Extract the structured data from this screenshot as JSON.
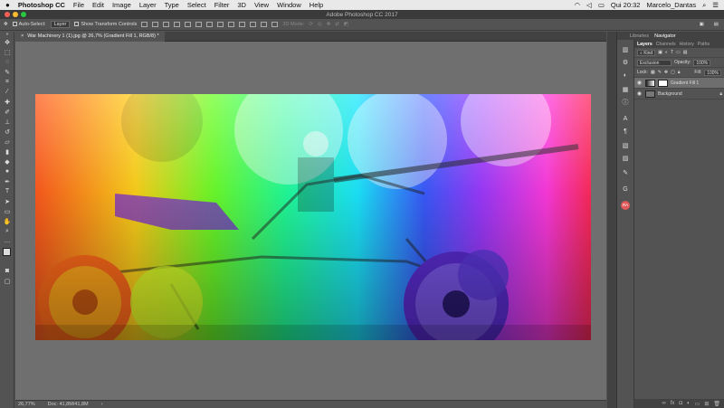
{
  "menubar": {
    "apple": "",
    "app_name": "Photoshop CC",
    "items": [
      "File",
      "Edit",
      "Image",
      "Layer",
      "Type",
      "Select",
      "Filter",
      "3D",
      "View",
      "Window",
      "Help"
    ],
    "clock": "Qui 20:32",
    "user": "Marcelo_Dantas"
  },
  "window": {
    "title": "Adobe Photoshop CC 2017"
  },
  "options": {
    "auto_select_label": "Auto-Select:",
    "auto_select_value": "Layer",
    "show_transform_label": "Show Transform Controls",
    "mode_3d": "3D Mode:"
  },
  "document": {
    "tab_title": "War Machinery 1 (1).jpg @ 26,7% (Gradient Fill 1, RGB/8) *"
  },
  "status": {
    "zoom": "26,77%",
    "doc": "Doc: 41,8M/41,8M"
  },
  "panels": {
    "top_tabs": [
      "Libraries",
      "Navigator"
    ],
    "layer_tabs": [
      "Layers",
      "Channels",
      "History",
      "Paths"
    ],
    "kind_label": "Kind",
    "blend_mode": "Exclusion",
    "opacity_label": "Opacity:",
    "opacity_value": "100%",
    "lock_label": "Lock:",
    "fill_label": "Fill:",
    "fill_value": "100%",
    "layers": [
      {
        "name": "Gradient Fill 1",
        "selected": true
      },
      {
        "name": "Background",
        "selected": false
      }
    ]
  },
  "colors": {
    "accent": "#e05a5a"
  }
}
